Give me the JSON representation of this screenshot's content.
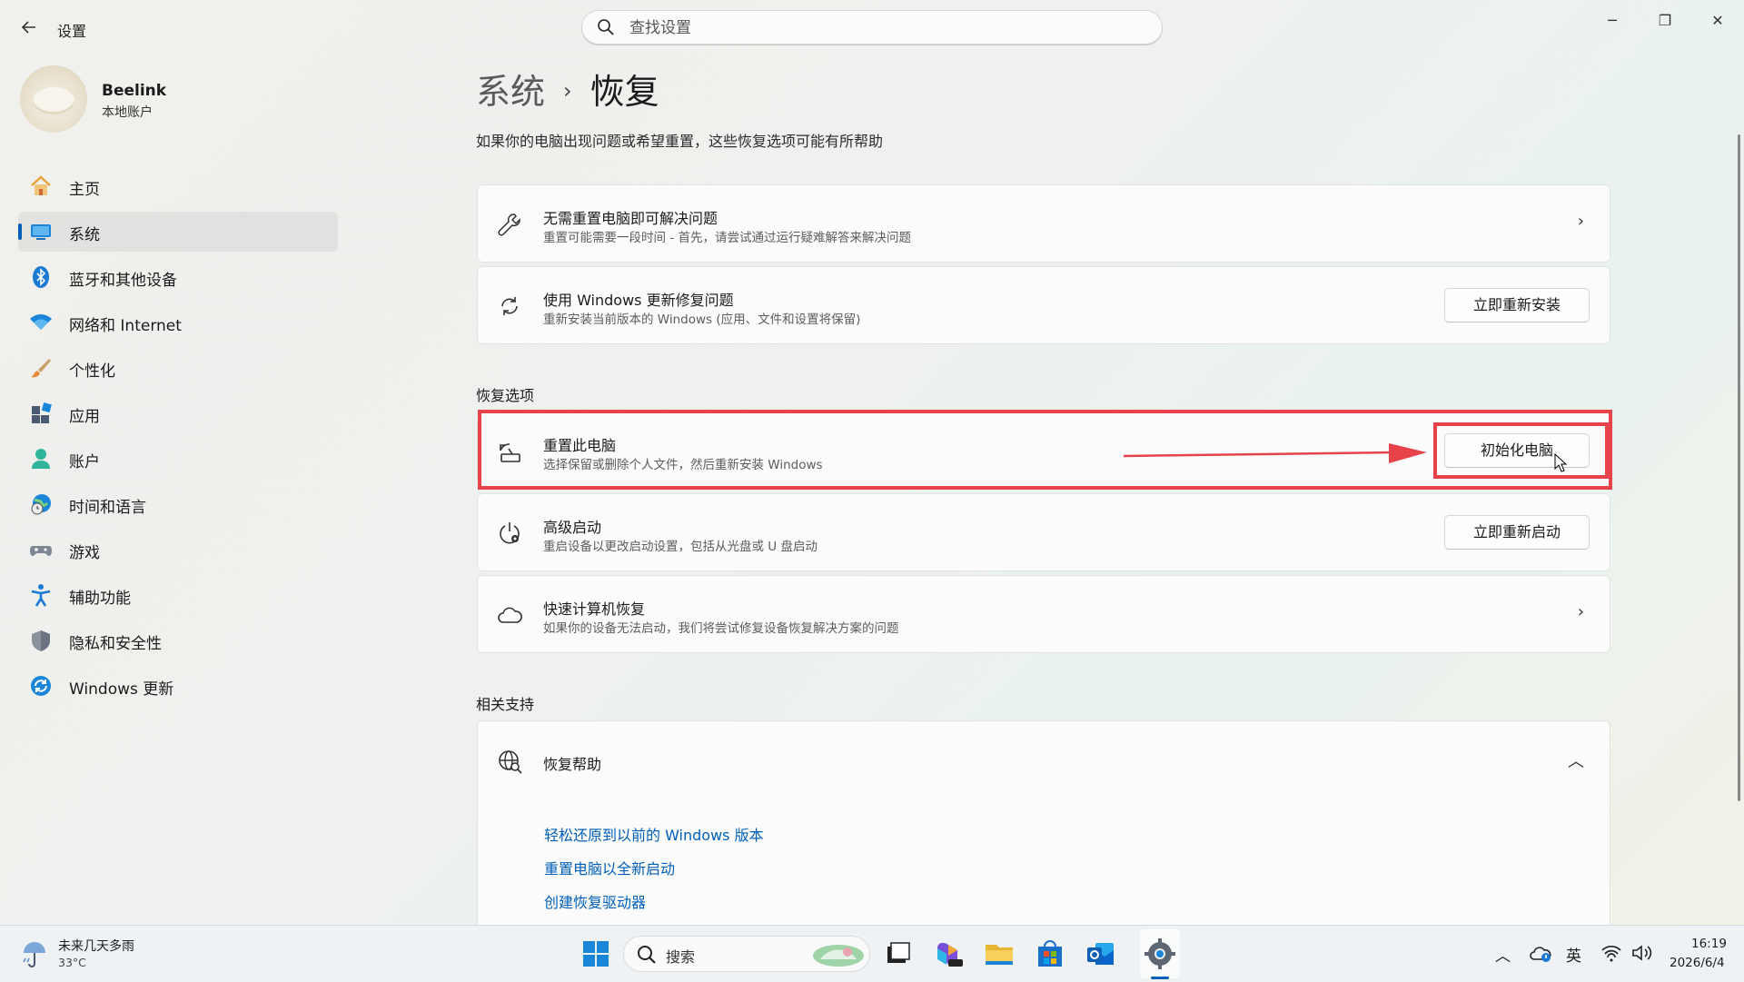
{
  "titlebar": {
    "back_icon": "arrow-left-icon",
    "app_title": "设置",
    "search_placeholder": "查找设置",
    "minimize": "─",
    "restore": "❐",
    "close": "✕"
  },
  "account": {
    "name": "Beelink",
    "type": "本地账户"
  },
  "nav": {
    "items": [
      {
        "label": "主页",
        "icon": "home-icon"
      },
      {
        "label": "系统",
        "icon": "system-display-icon",
        "active": true
      },
      {
        "label": "蓝牙和其他设备",
        "icon": "bluetooth-icon"
      },
      {
        "label": "网络和 Internet",
        "icon": "wifi-icon"
      },
      {
        "label": "个性化",
        "icon": "paintbrush-icon"
      },
      {
        "label": "应用",
        "icon": "apps-icon"
      },
      {
        "label": "账户",
        "icon": "person-icon"
      },
      {
        "label": "时间和语言",
        "icon": "globe-clock-icon"
      },
      {
        "label": "游戏",
        "icon": "gamepad-icon"
      },
      {
        "label": "辅助功能",
        "icon": "accessibility-icon"
      },
      {
        "label": "隐私和安全性",
        "icon": "shield-icon"
      },
      {
        "label": "Windows 更新",
        "icon": "update-icon"
      }
    ]
  },
  "main": {
    "breadcrumb_parent": "系统",
    "breadcrumb_sep": "›",
    "breadcrumb_current": "恢复",
    "description": "如果你的电脑出现问题或希望重置，这些恢复选项可能有所帮助",
    "cards_top": [
      {
        "title": "无需重置电脑即可解决问题",
        "subtitle": "重置可能需要一段时间 - 首先，请尝试通过运行疑难解答来解决问题",
        "icon": "wrench-icon",
        "chevron": "›"
      },
      {
        "title": "使用 Windows 更新修复问题",
        "subtitle": "重新安装当前版本的 Windows (应用、文件和设置将保留)",
        "icon": "sync-icon",
        "button": "立即重新安装"
      }
    ],
    "recovery_section_title": "恢复选项",
    "recovery_cards": [
      {
        "title": "重置此电脑",
        "subtitle": "选择保留或删除个人文件，然后重新安装 Windows",
        "icon": "reset-pc-icon",
        "button": "初始化电脑"
      },
      {
        "title": "高级启动",
        "subtitle": "重启设备以更改启动设置，包括从光盘或 U 盘启动",
        "icon": "advanced-startup-icon",
        "button": "立即重新启动"
      },
      {
        "title": "快速计算机恢复",
        "subtitle": "如果你的设备无法启动，我们将尝试修复设备恢复解决方案的问题",
        "icon": "cloud-icon",
        "chevron": "›"
      }
    ],
    "support_section_title": "相关支持",
    "help_card": {
      "title": "恢复帮助",
      "icon": "globe-search-icon",
      "chevron": "︿"
    },
    "help_links": [
      "轻松还原到以前的 Windows 版本",
      "重置电脑以全新启动",
      "创建恢复驱动器"
    ]
  },
  "colors": {
    "accent": "#005fb8",
    "annotation_red": "#e8434b"
  },
  "taskbar": {
    "weather_title": "未来几天多雨",
    "weather_temp": "33°C",
    "search_label": "搜索",
    "tray_lang": "英",
    "time": "16:19",
    "date": "2026/6/4",
    "icons": [
      "windows-start-icon",
      "search-icon",
      "task-view-icon",
      "microsoft-365-icon",
      "file-explorer-icon",
      "microsoft-store-icon",
      "outlook-icon",
      "settings-gear-icon"
    ]
  }
}
